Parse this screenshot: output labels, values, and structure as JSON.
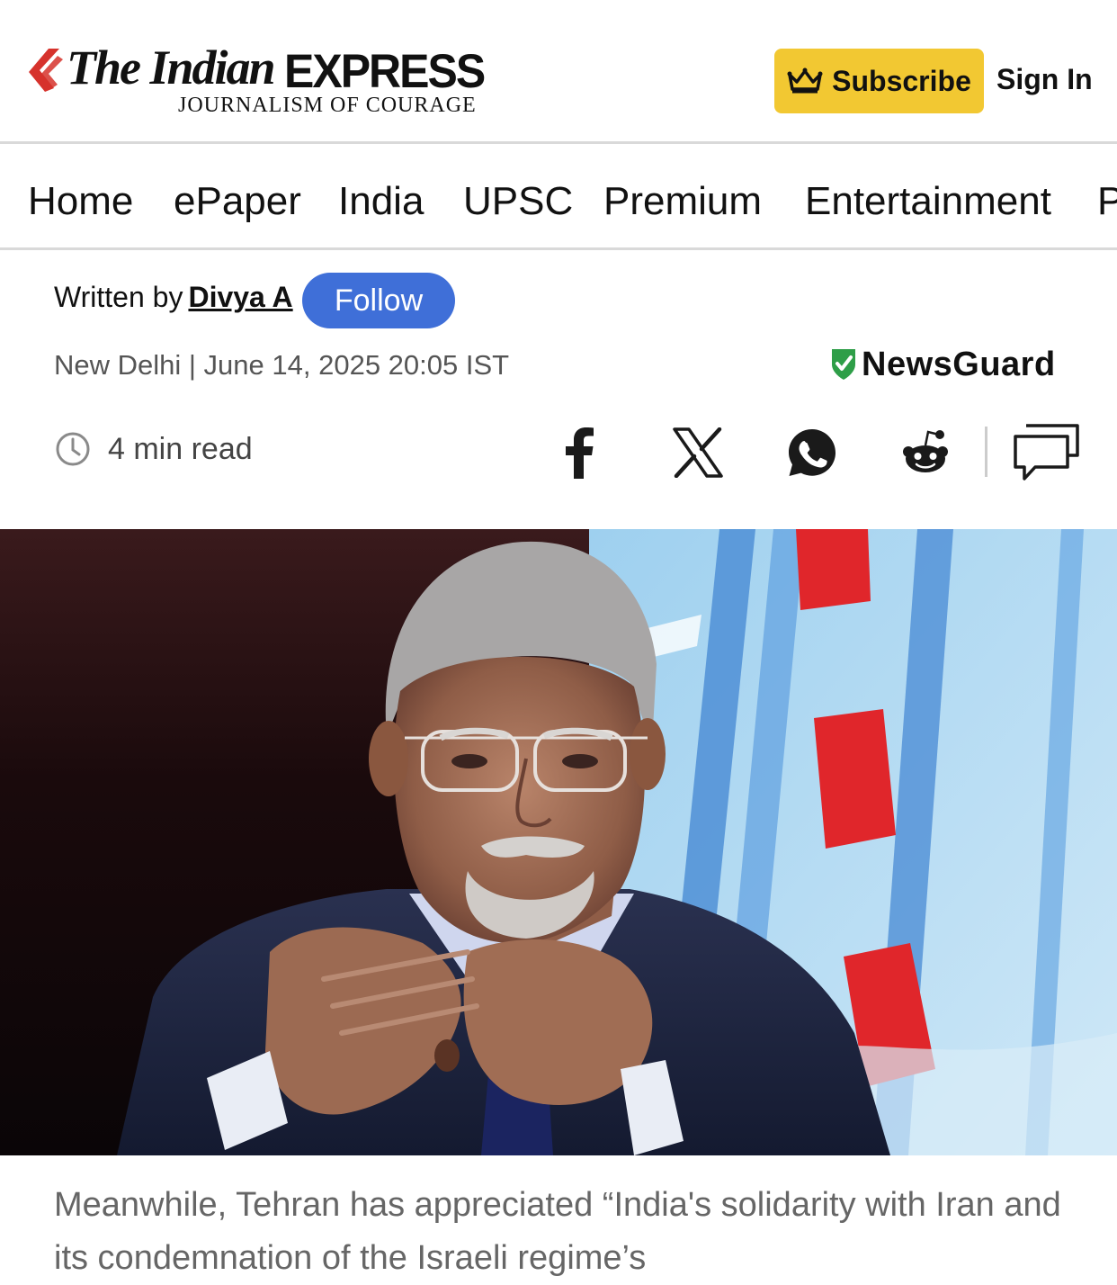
{
  "header": {
    "logo": {
      "the_indian": "The Indian",
      "express": "EXPRESS",
      "tagline": "JOURNALISM OF COURAGE"
    },
    "subscribe_label": "Subscribe",
    "subscribe_icon": "crown-icon",
    "signin_label": "Sign In"
  },
  "nav": {
    "items": [
      {
        "label": "Home"
      },
      {
        "label": "ePaper"
      },
      {
        "label": "India"
      },
      {
        "label": "UPSC"
      },
      {
        "label": "Premium"
      },
      {
        "label": "Entertainment"
      },
      {
        "label": "P"
      }
    ]
  },
  "article": {
    "written_by_label": "Written by",
    "author": "Divya A",
    "follow_label": "Follow",
    "dateline": "New Delhi | June 14, 2025 20:05 IST",
    "newsguard_label": "NewsGuard",
    "read_time": "4 min read",
    "share_icons": [
      "facebook-icon",
      "x-icon",
      "whatsapp-icon",
      "reddit-icon",
      "comments-icon"
    ],
    "lead": "Meanwhile, Tehran has appreciated “India's solidarity with Iran and its condemnation of the Israeli regime’s"
  },
  "colors": {
    "brand_red": "#d6322c",
    "subscribe_yellow": "#f2c832",
    "follow_blue": "#3f6fd8",
    "newsguard_green": "#2e9e48"
  }
}
